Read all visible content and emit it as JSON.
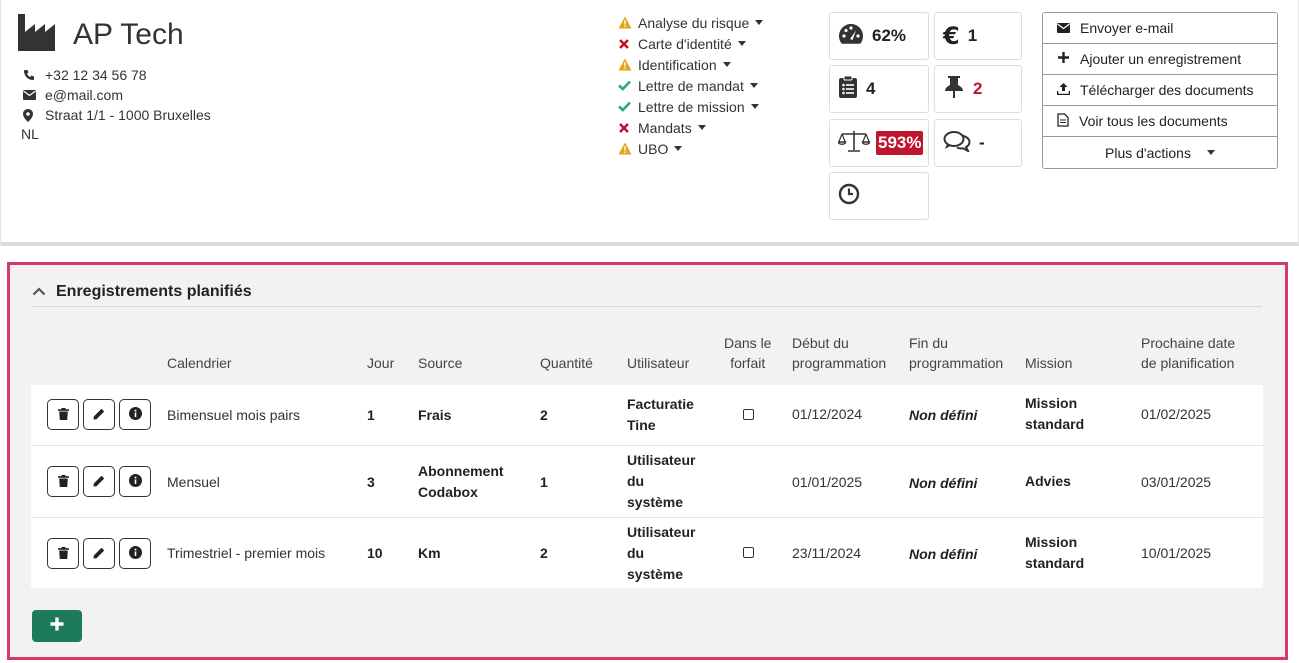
{
  "company": {
    "name": "AP Tech",
    "phone": "+32 12 34 56 78",
    "email": "e@mail.com",
    "address": "Straat 1/1 - 1000 Bruxelles",
    "language": "NL"
  },
  "checks": [
    {
      "label": "Analyse du risque",
      "status": "warning"
    },
    {
      "label": "Carte d'identité",
      "status": "error"
    },
    {
      "label": "Identification",
      "status": "warning"
    },
    {
      "label": "Lettre de mandat",
      "status": "ok"
    },
    {
      "label": "Lettre de mission",
      "status": "ok"
    },
    {
      "label": "Mandats",
      "status": "error"
    },
    {
      "label": "UBO",
      "status": "warning"
    }
  ],
  "stats": {
    "dashboard": "62%",
    "euro": "1",
    "tasks": "4",
    "pins": "2",
    "balance": "593%",
    "comments": "-",
    "clock": ""
  },
  "actions": {
    "send_email": "Envoyer e-mail",
    "add_record": "Ajouter un enregistrement",
    "upload_docs": "Télécharger des documents",
    "view_docs": "Voir tous les documents",
    "more": "Plus d'actions"
  },
  "section": {
    "title": "Enregistrements planifiés"
  },
  "table": {
    "headers": {
      "calendar": "Calendrier",
      "day": "Jour",
      "source": "Source",
      "quantity": "Quantité",
      "user": "Utilisateur",
      "in_package_1": "Dans le",
      "in_package_2": "forfait",
      "start_1": "Début du",
      "start_2": "programmation",
      "end_1": "Fin du",
      "end_2": "programmation",
      "mission": "Mission",
      "next_1": "Prochaine date",
      "next_2": "de planification"
    },
    "rows": [
      {
        "calendar": "Bimensuel mois pairs",
        "day": "1",
        "source_1": "Frais",
        "source_2": "",
        "quantity": "2",
        "user_1": "Facturatie",
        "user_2": "Tine",
        "user_3": "",
        "in_package": true,
        "start": "01/12/2024",
        "end": "Non défini",
        "mission_1": "Mission",
        "mission_2": "standard",
        "next": "01/02/2025"
      },
      {
        "calendar": "Mensuel",
        "day": "3",
        "source_1": "Abonnement",
        "source_2": "Codabox",
        "quantity": "1",
        "user_1": "Utilisateur",
        "user_2": "du",
        "user_3": "système",
        "in_package": false,
        "start": "01/01/2025",
        "end": "Non défini",
        "mission_1": "Advies",
        "mission_2": "",
        "next": "03/01/2025"
      },
      {
        "calendar": "Trimestriel - premier mois",
        "day": "10",
        "source_1": "Km",
        "source_2": "",
        "quantity": "2",
        "user_1": "Utilisateur",
        "user_2": "du",
        "user_3": "système",
        "in_package": true,
        "start": "23/11/2024",
        "end": "Non défini",
        "mission_1": "Mission",
        "mission_2": "standard",
        "next": "10/01/2025"
      }
    ]
  },
  "colors": {
    "accent_border": "#d63b63",
    "add_button": "#1d7a5a",
    "warning": "#e8a317",
    "error": "#c0152f",
    "ok": "#2aa784"
  }
}
